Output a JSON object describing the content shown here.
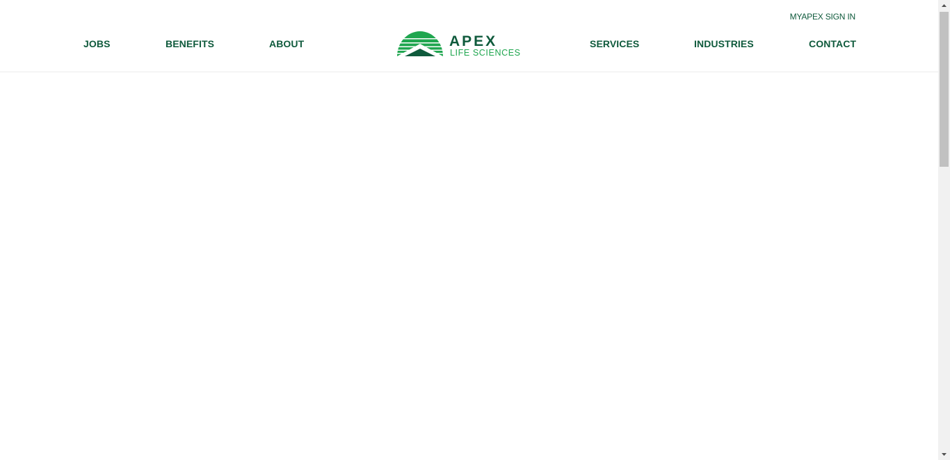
{
  "header": {
    "signin_label": "MYAPEX SIGN IN",
    "nav_left": [
      {
        "label": "JOBS"
      },
      {
        "label": "BENEFITS"
      },
      {
        "label": "ABOUT"
      }
    ],
    "nav_right": [
      {
        "label": "SERVICES"
      },
      {
        "label": "INDUSTRIES"
      },
      {
        "label": "CONTACT"
      }
    ],
    "logo": {
      "name": "APEX",
      "tagline": "LIFE SCIENCES",
      "icon": "mountain-sun-icon"
    }
  },
  "colors": {
    "brand_dark": "#0f5a3c",
    "brand_light": "#1fa64f"
  }
}
